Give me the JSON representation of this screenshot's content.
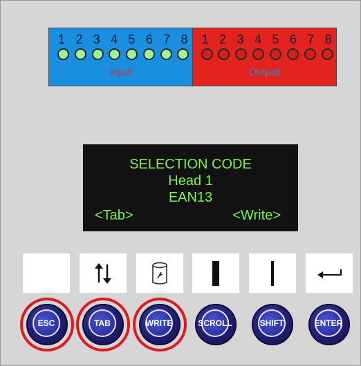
{
  "io": {
    "numbers": [
      "1",
      "2",
      "3",
      "4",
      "5",
      "6",
      "7",
      "8"
    ],
    "input_label": "Input",
    "output_label": "Output",
    "input_color": "#1a8fe0",
    "output_color": "#e2231e",
    "input_led_color": "#9ff29a",
    "output_led_color": "#d42018"
  },
  "display": {
    "line1": "SELECTION CODE",
    "line2": "Head 1",
    "line3": "EAN13",
    "soft_left": "<Tab>",
    "soft_right": "<Write>",
    "text_color": "#7cf24a"
  },
  "key_icons": [
    "blank",
    "up-down-arrows-icon",
    "can-icon",
    "thick-bar-icon",
    "thin-bar-icon",
    "return-arrow-icon"
  ],
  "buttons": {
    "esc": "ESC",
    "tab": "TAB",
    "write": "WRITE",
    "scroll": "SCROLL",
    "shift": "SHIFT",
    "enter": "ENTER"
  },
  "highlight_color": "#e1191f"
}
